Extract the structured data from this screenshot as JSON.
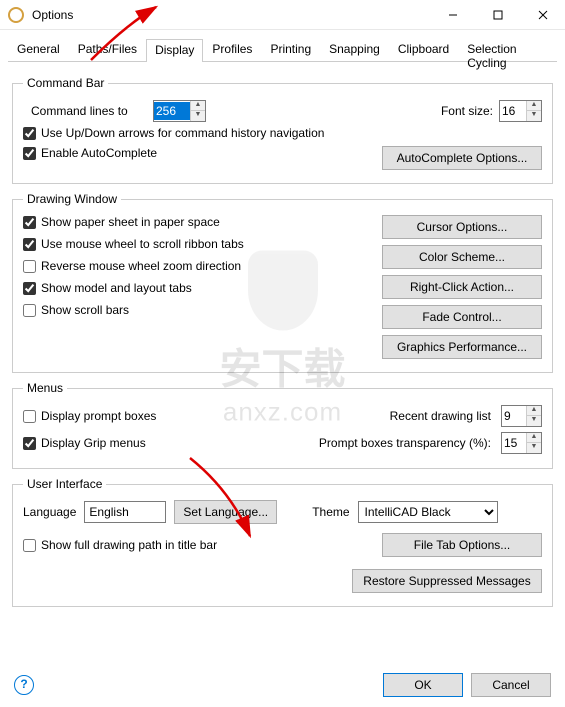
{
  "window": {
    "title": "Options"
  },
  "tabs": [
    "General",
    "Paths/Files",
    "Display",
    "Profiles",
    "Printing",
    "Snapping",
    "Clipboard",
    "Selection Cycling"
  ],
  "activeTab": "Display",
  "commandBar": {
    "legend": "Command Bar",
    "linesLabel": "Command lines to",
    "linesValue": "256",
    "fontSizeLabel": "Font size:",
    "fontSizeValue": "16",
    "useArrows": "Use Up/Down arrows for command history navigation",
    "enableAuto": "Enable AutoComplete",
    "autoBtn": "AutoComplete Options..."
  },
  "drawingWindow": {
    "legend": "Drawing Window",
    "showPaper": "Show paper sheet in paper space",
    "useWheel": "Use mouse wheel to scroll ribbon tabs",
    "reverseWheel": "Reverse mouse wheel zoom direction",
    "showModel": "Show model and layout tabs",
    "showScroll": "Show scroll bars",
    "cursorBtn": "Cursor Options...",
    "colorBtn": "Color Scheme...",
    "rightClickBtn": "Right-Click Action...",
    "fadeBtn": "Fade Control...",
    "graphicsBtn": "Graphics Performance..."
  },
  "menus": {
    "legend": "Menus",
    "dispPrompt": "Display prompt boxes",
    "dispGrip": "Display Grip menus",
    "recentLabel": "Recent drawing list",
    "recentVal": "9",
    "transLabel": "Prompt boxes transparency (%):",
    "transVal": "15"
  },
  "ui": {
    "legend": "User Interface",
    "langLabel": "Language",
    "langVal": "English",
    "setLangBtn": "Set Language...",
    "themeLabel": "Theme",
    "themeVal": "IntelliCAD Black",
    "showPath": "Show full drawing path in title bar",
    "fileTabBtn": "File Tab Options...",
    "restoreBtn": "Restore Suppressed Messages"
  },
  "footer": {
    "ok": "OK",
    "cancel": "Cancel"
  },
  "watermark": {
    "t1": "安下载",
    "t2": "anxz.com"
  }
}
